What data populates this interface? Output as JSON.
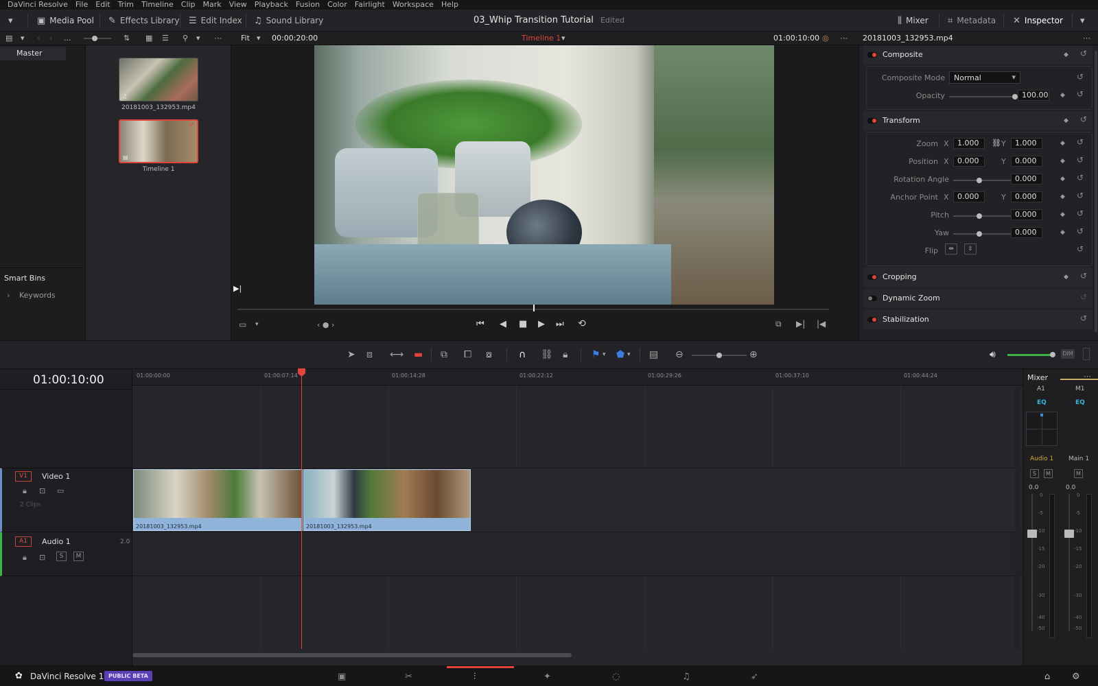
{
  "menubar": {
    "items": [
      "DaVinci Resolve",
      "File",
      "Edit",
      "Trim",
      "Timeline",
      "Clip",
      "Mark",
      "View",
      "Playback",
      "Fusion",
      "Color",
      "Fairlight",
      "Workspace",
      "Help"
    ]
  },
  "toolbar": {
    "media_pool": "Media Pool",
    "effects_library": "Effects Library",
    "edit_index": "Edit Index",
    "sound_library": "Sound Library",
    "project_title": "03_Whip Transition Tutorial",
    "project_status": "Edited",
    "mixer": "Mixer",
    "metadata": "Metadata",
    "inspector": "Inspector"
  },
  "subbar": {
    "more": "...",
    "fit": "Fit",
    "duration": "00:00:20:00",
    "timeline_name": "Timeline 1",
    "timecode": "01:00:10:00",
    "inspector_clip": "20181003_132953.mp4"
  },
  "bins": {
    "master": "Master",
    "smart_bins": "Smart Bins",
    "keywords": "Keywords"
  },
  "media": [
    {
      "label": "20181003_132953.mp4"
    },
    {
      "label": "Timeline 1"
    }
  ],
  "inspector": {
    "composite": {
      "title": "Composite",
      "mode_label": "Composite Mode",
      "mode_value": "Normal",
      "opacity_label": "Opacity",
      "opacity_value": "100.00",
      "opacity_fraction": 1.0
    },
    "transform": {
      "title": "Transform",
      "zoom_label": "Zoom",
      "zoom_x": "1.000",
      "zoom_y": "1.000",
      "position_label": "Position",
      "position_x": "0.000",
      "position_y": "0.000",
      "rotation_label": "Rotation Angle",
      "rotation_value": "0.000",
      "anchor_label": "Anchor Point",
      "anchor_x": "0.000",
      "anchor_y": "0.000",
      "pitch_label": "Pitch",
      "pitch_value": "0.000",
      "yaw_label": "Yaw",
      "yaw_value": "0.000",
      "flip_label": "Flip",
      "x": "X",
      "y": "Y"
    },
    "cropping": "Cropping",
    "dynamic_zoom": "Dynamic Zoom",
    "stabilization": "Stabilization"
  },
  "timeline": {
    "current_timecode": "01:00:10:00",
    "ruler": [
      "01:00:00:00",
      "01:00:07:14",
      "01:00:14:28",
      "01:00:22:12",
      "01:00:29:26",
      "01:00:37:10",
      "01:00:44:24"
    ],
    "video_track": {
      "badge": "V1",
      "name": "Video 1",
      "clips_count": "2 Clips"
    },
    "audio_track": {
      "badge": "A1",
      "name": "Audio 1",
      "channels": "2.0",
      "solo": "S",
      "mute": "M"
    },
    "clips": [
      {
        "name": "20181003_132953.mp4"
      },
      {
        "name": "20181003_132953.mp4"
      }
    ]
  },
  "mixer": {
    "title": "Mixer",
    "channels": [
      "A1",
      "M1"
    ],
    "eq": "EQ",
    "track_names": [
      "Audio 1",
      "Main 1"
    ],
    "solo": "S",
    "mute": "M",
    "levels": [
      "0.0",
      "0.0"
    ],
    "scale": [
      "0",
      "-5",
      "-10",
      "-15",
      "-20",
      "-30",
      "-40",
      "-50"
    ],
    "dim": "DIM"
  },
  "bottombar": {
    "app": "DaVinci Resolve 16",
    "badge": "PUBLIC BETA"
  },
  "colors": {
    "accent_red": "#e0443a",
    "clip_blue": "#8fb3d9",
    "playhead": "#e0443a"
  }
}
